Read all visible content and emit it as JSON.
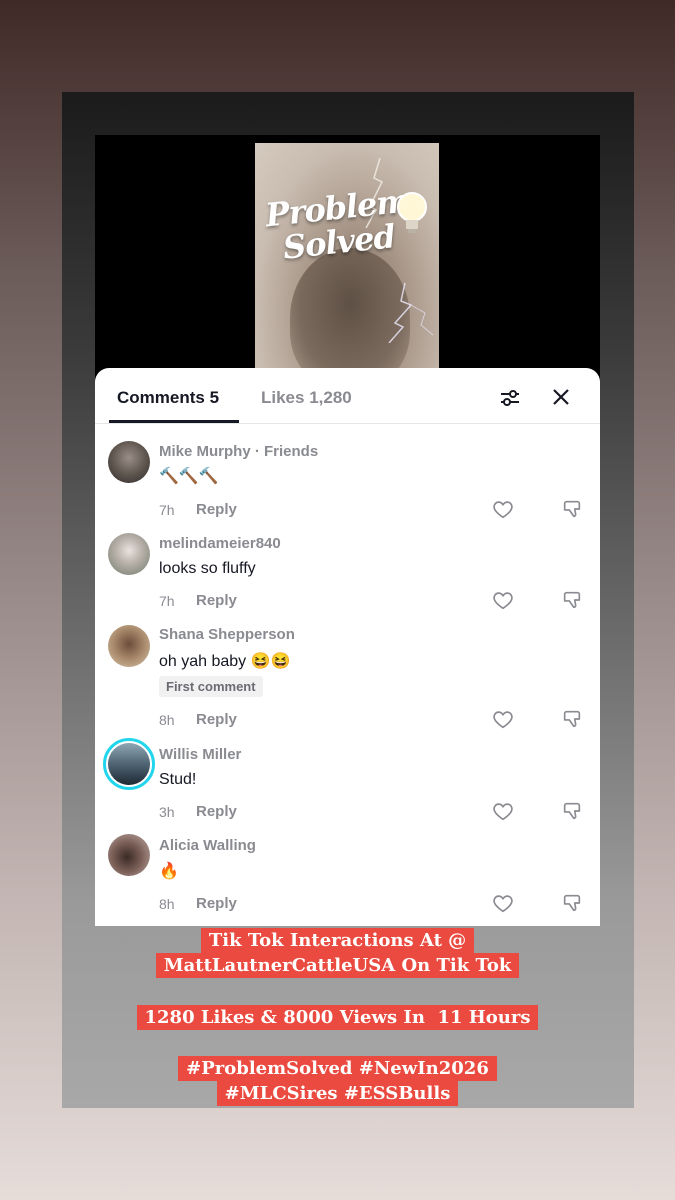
{
  "thumbnail": {
    "brand_text": "Problem Solved"
  },
  "sheet": {
    "tabs": {
      "comments_label": "Comments 5",
      "likes_label": "Likes 1,280"
    },
    "icons": {
      "filter": "sliders-icon",
      "close": "close-icon"
    }
  },
  "comments": [
    {
      "username": "Mike Murphy · Friends",
      "text": "🔨🔨🔨",
      "time": "7h",
      "reply": "Reply"
    },
    {
      "username": "melindameier840",
      "text": "looks so fluffy",
      "time": "7h",
      "reply": "Reply"
    },
    {
      "username": "Shana Shepperson",
      "text": "oh yah baby 😆😆",
      "badge": "First comment",
      "time": "8h",
      "reply": "Reply"
    },
    {
      "username": "Willis Miller",
      "text": "Stud!",
      "time": "3h",
      "reply": "Reply"
    },
    {
      "username": "Alicia Walling",
      "text": "🔥",
      "time": "8h",
      "reply": "Reply"
    }
  ],
  "caption": {
    "line1": "Tik Tok Interactions At @",
    "line2": "MattLautnerCattleUSA On Tik Tok",
    "line3": "1280 Likes & 8000 Views In  11 Hours",
    "line4": "#ProblemSolved #NewIn2026",
    "line5": "#MLCSires #ESSBulls"
  },
  "colors": {
    "caption_bg": "#ea4a3f",
    "story_ring": "#20d5ec",
    "text_primary": "#161823",
    "text_secondary": "#8a8b91"
  }
}
